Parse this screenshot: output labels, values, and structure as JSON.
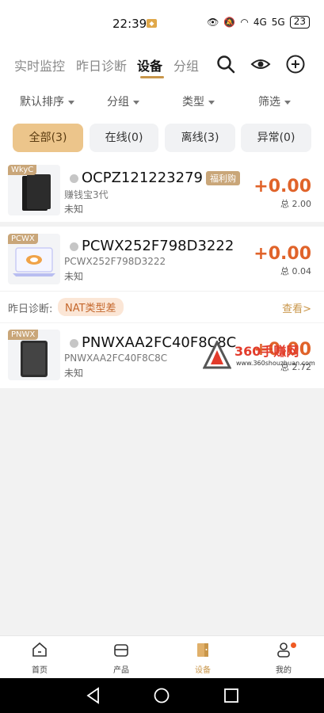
{
  "status": {
    "time": "22:39",
    "battery": "23",
    "network1": "4G",
    "network2": "5G"
  },
  "topnav": {
    "tabs": [
      {
        "label": "实时监控"
      },
      {
        "label": "昨日诊断"
      },
      {
        "label": "设备"
      },
      {
        "label": "分组"
      }
    ]
  },
  "filters": [
    "默认排序",
    "分组",
    "类型",
    "筛选"
  ],
  "states": [
    {
      "label": "全部(3)"
    },
    {
      "label": "在线(0)"
    },
    {
      "label": "离线(3)"
    },
    {
      "label": "异常(0)"
    }
  ],
  "devices": [
    {
      "tag": "WkyC",
      "name": "OCPZ121223279",
      "badge": "福利购",
      "sub": "赚钱宝3代",
      "status": "未知",
      "earning": "+0.00",
      "total": "总 2.00"
    },
    {
      "tag": "PCWX",
      "name": "PCWX252F798D3222",
      "sub": "PCWX252F798D3222",
      "status": "未知",
      "earning": "+0.00",
      "total": "总 0.04"
    },
    {
      "tag": "PNWX",
      "name": "PNWXAA2FC40F8C8C",
      "sub": "PNWXAA2FC40F8C8C",
      "status": "未知",
      "earning": "+0.00",
      "total": "总 2.72"
    }
  ],
  "diagnosis": {
    "label": "昨日诊断:",
    "issue": "NAT类型差",
    "view": "查看>"
  },
  "watermark": {
    "text": "360手赚网",
    "url": "www.360shouzhuan.com"
  },
  "bottom": [
    {
      "label": "首页",
      "icon": "home-icon"
    },
    {
      "label": "产品",
      "icon": "product-icon"
    },
    {
      "label": "设备",
      "icon": "device-icon"
    },
    {
      "label": "我的",
      "icon": "profile-icon"
    }
  ],
  "colors": {
    "accent": "#c9964a",
    "earning": "#e0632a",
    "chip_active": "#ecc58b"
  }
}
